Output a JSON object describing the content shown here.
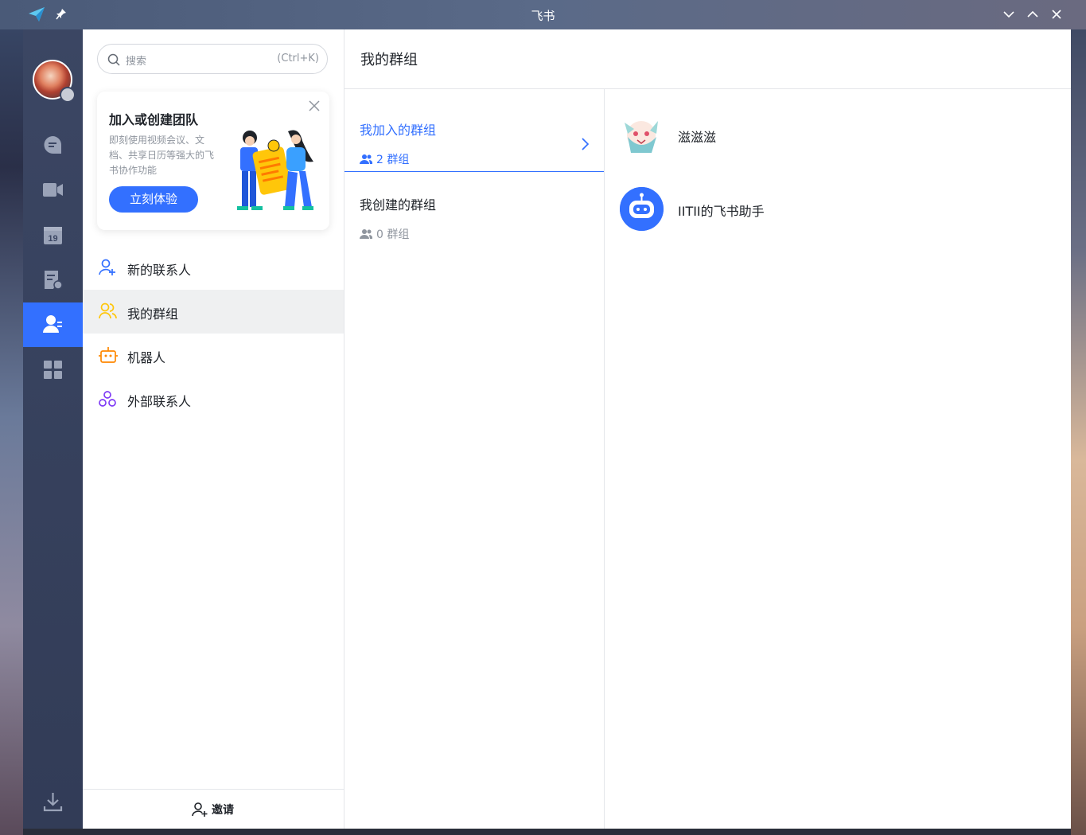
{
  "window": {
    "title": "飞书"
  },
  "search": {
    "placeholder": "搜索",
    "hotkey": "(Ctrl+K)"
  },
  "promo": {
    "title": "加入或创建团队",
    "description": "即刻使用视频会议、文档、共享日历等强大的飞书协作功能",
    "button": "立刻体验"
  },
  "rail": {
    "calendar_day": "19",
    "items": [
      "chat-icon",
      "video-icon",
      "calendar-icon",
      "docs-icon",
      "contacts-icon",
      "workplace-icon",
      "download-icon"
    ]
  },
  "nav": {
    "items": [
      {
        "label": "新的联系人",
        "icon": "add-contact-icon",
        "color": "#3370ff"
      },
      {
        "label": "我的群组",
        "icon": "group-icon",
        "color": "#ffc60a"
      },
      {
        "label": "机器人",
        "icon": "robot-icon",
        "color": "#ff8800"
      },
      {
        "label": "外部联系人",
        "icon": "external-contact-icon",
        "color": "#7f3bf5"
      }
    ],
    "active_index": 1
  },
  "invite": {
    "label": "邀请"
  },
  "header": {
    "title": "我的群组"
  },
  "groups": {
    "joined": {
      "label": "我加入的群组",
      "count": "2 群组"
    },
    "created": {
      "label": "我创建的群组",
      "count": "0 群组"
    }
  },
  "group_list": [
    {
      "name": "滋滋滋"
    },
    {
      "name": "IITII的飞书助手"
    }
  ],
  "colors": {
    "accent": "#3370ff",
    "rail_bg": "#3b4663",
    "muted": "#8f959e"
  }
}
